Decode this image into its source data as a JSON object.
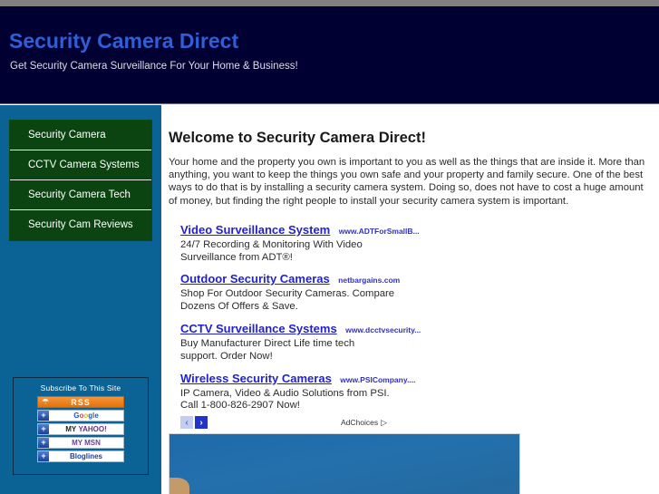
{
  "header": {
    "title": "Security Camera Direct",
    "tagline": "Get Security Camera Surveillance For Your Home & Business!",
    "title_color": "#2f5fd6",
    "bg_color": "#000033"
  },
  "sidebar": {
    "bg_color": "#0a6394",
    "nav": {
      "items": [
        {
          "label": "Security Camera"
        },
        {
          "label": "CCTV Camera Systems"
        },
        {
          "label": "Security Camera Tech"
        },
        {
          "label": "Security Cam Reviews"
        }
      ]
    },
    "subscribe": {
      "title": "Subscribe To This Site",
      "rss": {
        "label": "RSS",
        "icon": "rss-icon",
        "color": "#e2720d"
      },
      "buttons": [
        {
          "label": "Google",
          "icon": "plus-icon"
        },
        {
          "label": "MY YAHOO!",
          "icon": "plus-icon"
        },
        {
          "label": "MY MSN",
          "icon": "plus-icon"
        },
        {
          "label": "Bloglines",
          "icon": "plus-icon"
        }
      ]
    }
  },
  "main": {
    "welcome_title": "Welcome to Security Camera Direct!",
    "intro_text": "Your home and the property you own is important to you as well as the things that are inside it. More than anything, you want to keep the things you own safe and your property and family secure. One of the best ways to do that is by installing a security camera system. Doing so, does not have to cost a huge amount of money, but finding the right people to install your security camera system is important.",
    "ads": [
      {
        "title": "Video Surveillance System",
        "url": "www.ADTForSmallB...",
        "desc": "24/7 Recording & Monitoring With Video Surveillance from ADT®!"
      },
      {
        "title": "Outdoor Security Cameras",
        "url": "netbargains.com",
        "desc": "Shop For Outdoor Security Cameras. Compare Dozens Of Offers & Save."
      },
      {
        "title": "CCTV Surveillance Systems",
        "url": "www.dcctvsecurity...",
        "desc": "Buy Manufacturer Direct Life time tech support. Order Now!"
      },
      {
        "title": "Wireless Security Cameras",
        "url": "www.PSICompany....",
        "desc": "IP Camera, Video & Audio Solutions from PSI. Call 1-800-826-2907 Now!"
      }
    ],
    "pager": {
      "prev_label": "‹",
      "next_label": "›"
    },
    "adchoices": {
      "label": "AdChoices",
      "icon": "triangle-right-icon"
    }
  }
}
